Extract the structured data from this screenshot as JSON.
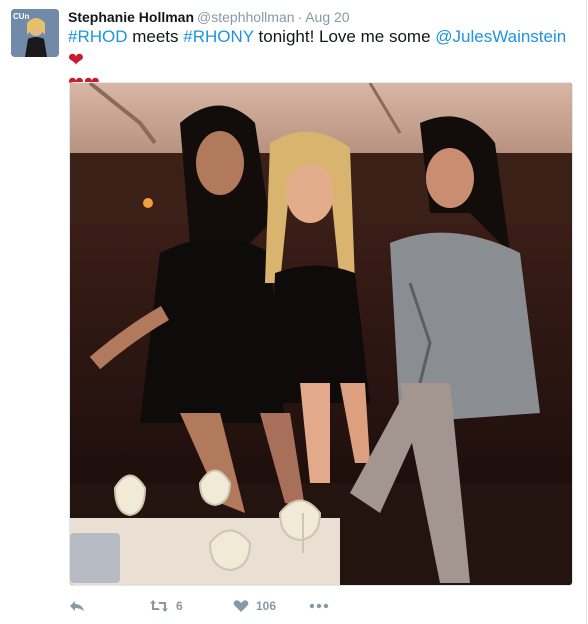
{
  "tweet": {
    "author_name": "Stephanie Hollman",
    "author_handle": "@stephhollman",
    "separator": "·",
    "date": "Aug 20",
    "text": {
      "tag1": "#RHOD",
      "part1": " meets ",
      "tag2": "#RHONY",
      "part2": " tonight!  Love me some ",
      "mention": "@JulesWainstein"
    }
  },
  "avatar": {
    "logo_text": "CUn"
  },
  "actions": {
    "retweet_count": "6",
    "like_count": "106"
  },
  "colors": {
    "link": "#1b95e0",
    "heart": "#c91b2e",
    "meta": "#8899a6"
  },
  "icons": [
    "reply-icon",
    "retweet-icon",
    "like-icon",
    "more-icon",
    "heart-emoji"
  ]
}
